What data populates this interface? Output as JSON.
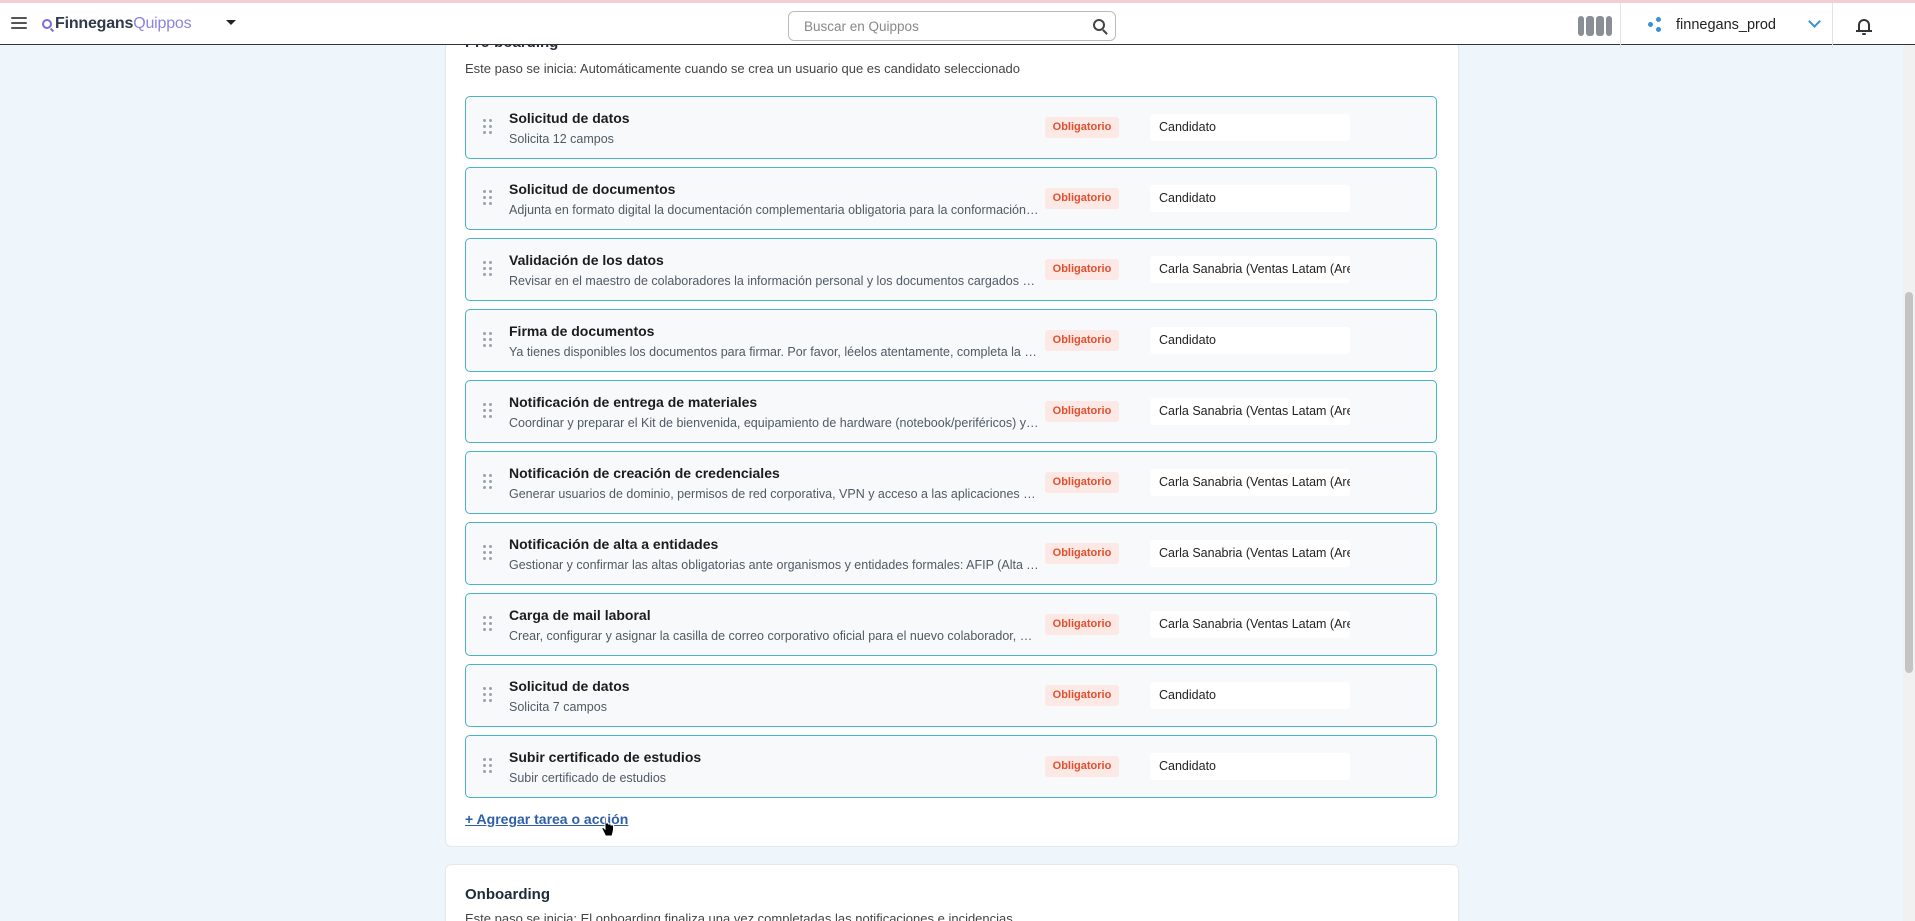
{
  "header": {
    "brand_part1": "Finnegans",
    "brand_part2": "Quippos",
    "search_placeholder": "Buscar en Quippos",
    "tenant": "finnegans_prod"
  },
  "preboarding": {
    "title": "Pre-boarding",
    "description": "Este paso se inicia: Automáticamente cuando se crea un usuario que es candidato seleccionado",
    "tasks": [
      {
        "title": "Solicitud de datos",
        "subtitle": "Solicita 12 campos",
        "badge": "Obligatorio",
        "assignee": "Candidato"
      },
      {
        "title": "Solicitud de documentos",
        "subtitle": "Adjunta en formato digital la documentación complementaria obligatoria para la conformación d...",
        "badge": "Obligatorio",
        "assignee": "Candidato"
      },
      {
        "title": "Validación de los datos",
        "subtitle": "Revisar en el maestro de colaboradores la información personal y los documentos cargados por ...",
        "badge": "Obligatorio",
        "assignee": "Carla Sanabria (Ventas Latam (Area"
      },
      {
        "title": "Firma de documentos",
        "subtitle": "Ya tienes disponibles los documentos para firmar. Por favor, léelos atentamente, completa la info...",
        "badge": "Obligatorio",
        "assignee": "Candidato"
      },
      {
        "title": "Notificación de entrega de materiales",
        "subtitle": "Coordinar y preparar el Kit de bienvenida, equipamiento de hardware (notebook/periféricos) y tarj...",
        "badge": "Obligatorio",
        "assignee": "Carla Sanabria (Ventas Latam (Area"
      },
      {
        "title": "Notificación de creación de credenciales",
        "subtitle": "Generar usuarios de dominio, permisos de red corporativa, VPN y acceso a las aplicaciones orga...",
        "badge": "Obligatorio",
        "assignee": "Carla Sanabria (Ventas Latam (Area"
      },
      {
        "title": "Notificación de alta a entidades",
        "subtitle": "Gestionar y confirmar las altas obligatorias ante organismos y entidades formales: AFIP (Alta Te...",
        "badge": "Obligatorio",
        "assignee": "Carla Sanabria (Ventas Latam (Area"
      },
      {
        "title": "Carga de mail laboral",
        "subtitle": "Crear, configurar y asignar la casilla de correo corporativo oficial para el nuevo colaborador, notifi...",
        "badge": "Obligatorio",
        "assignee": "Carla Sanabria (Ventas Latam (Area"
      },
      {
        "title": "Solicitud de datos",
        "subtitle": "Solicita 7 campos",
        "badge": "Obligatorio",
        "assignee": "Candidato"
      },
      {
        "title": "Subir certificado de estudios",
        "subtitle": "Subir certificado de estudios",
        "badge": "Obligatorio",
        "assignee": "Candidato"
      }
    ],
    "add_link": "+ Agregar tarea o acción"
  },
  "onboarding": {
    "title": "Onboarding",
    "description": "Este paso se inicia: El onboarding finaliza una vez completadas las notificaciones e incidencias"
  },
  "colors": {
    "accent": "#48b3c9",
    "badge_text": "#e0502f",
    "badge_bg": "#fce8e4",
    "link": "#2f5fa8",
    "brand_purple": "#8b84e0"
  },
  "icons": [
    "hamburger-menu-icon",
    "quippos-logo-icon",
    "caret-down-icon",
    "search-icon",
    "user-avatar-icon",
    "share-nodes-icon",
    "chevron-down-icon",
    "bell-icon",
    "drag-handle-icon",
    "pointer-cursor-icon"
  ]
}
